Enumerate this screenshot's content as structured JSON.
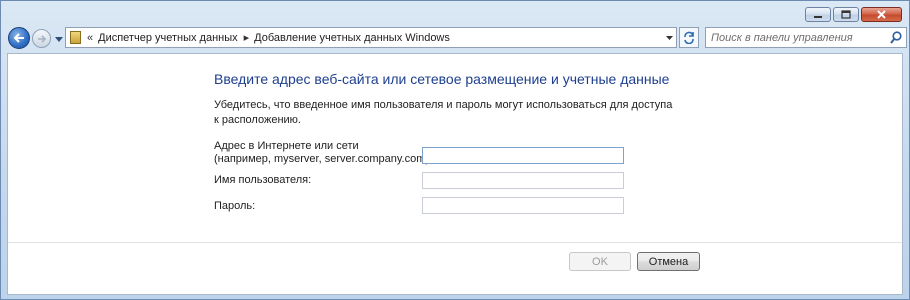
{
  "window": {
    "caption_buttons": [
      "minimize",
      "maximize",
      "close"
    ]
  },
  "nav": {
    "breadcrumbs": [
      "Диспетчер учетных данных",
      "Добавление учетных данных Windows"
    ],
    "breadcrumb_overflow": "«",
    "breadcrumb_separator": "▸"
  },
  "search": {
    "placeholder": "Поиск в панели управления"
  },
  "form": {
    "heading": "Введите адрес веб-сайта или сетевое размещение и учетные данные",
    "description": "Убедитесь, что введенное имя пользователя и пароль могут использоваться для доступа к расположению.",
    "address_label_line1": "Адрес в Интернете или сети",
    "address_label_line2": "(например, myserver, server.company.com):",
    "address_value": "",
    "username_label": "Имя пользователя:",
    "username_value": "",
    "password_label": "Пароль:",
    "password_value": ""
  },
  "buttons": {
    "ok": "OK",
    "cancel": "Отмена"
  },
  "colors": {
    "heading": "#1e3f8f",
    "frame": "#c4d8ee",
    "close_button": "#c44b2e"
  }
}
